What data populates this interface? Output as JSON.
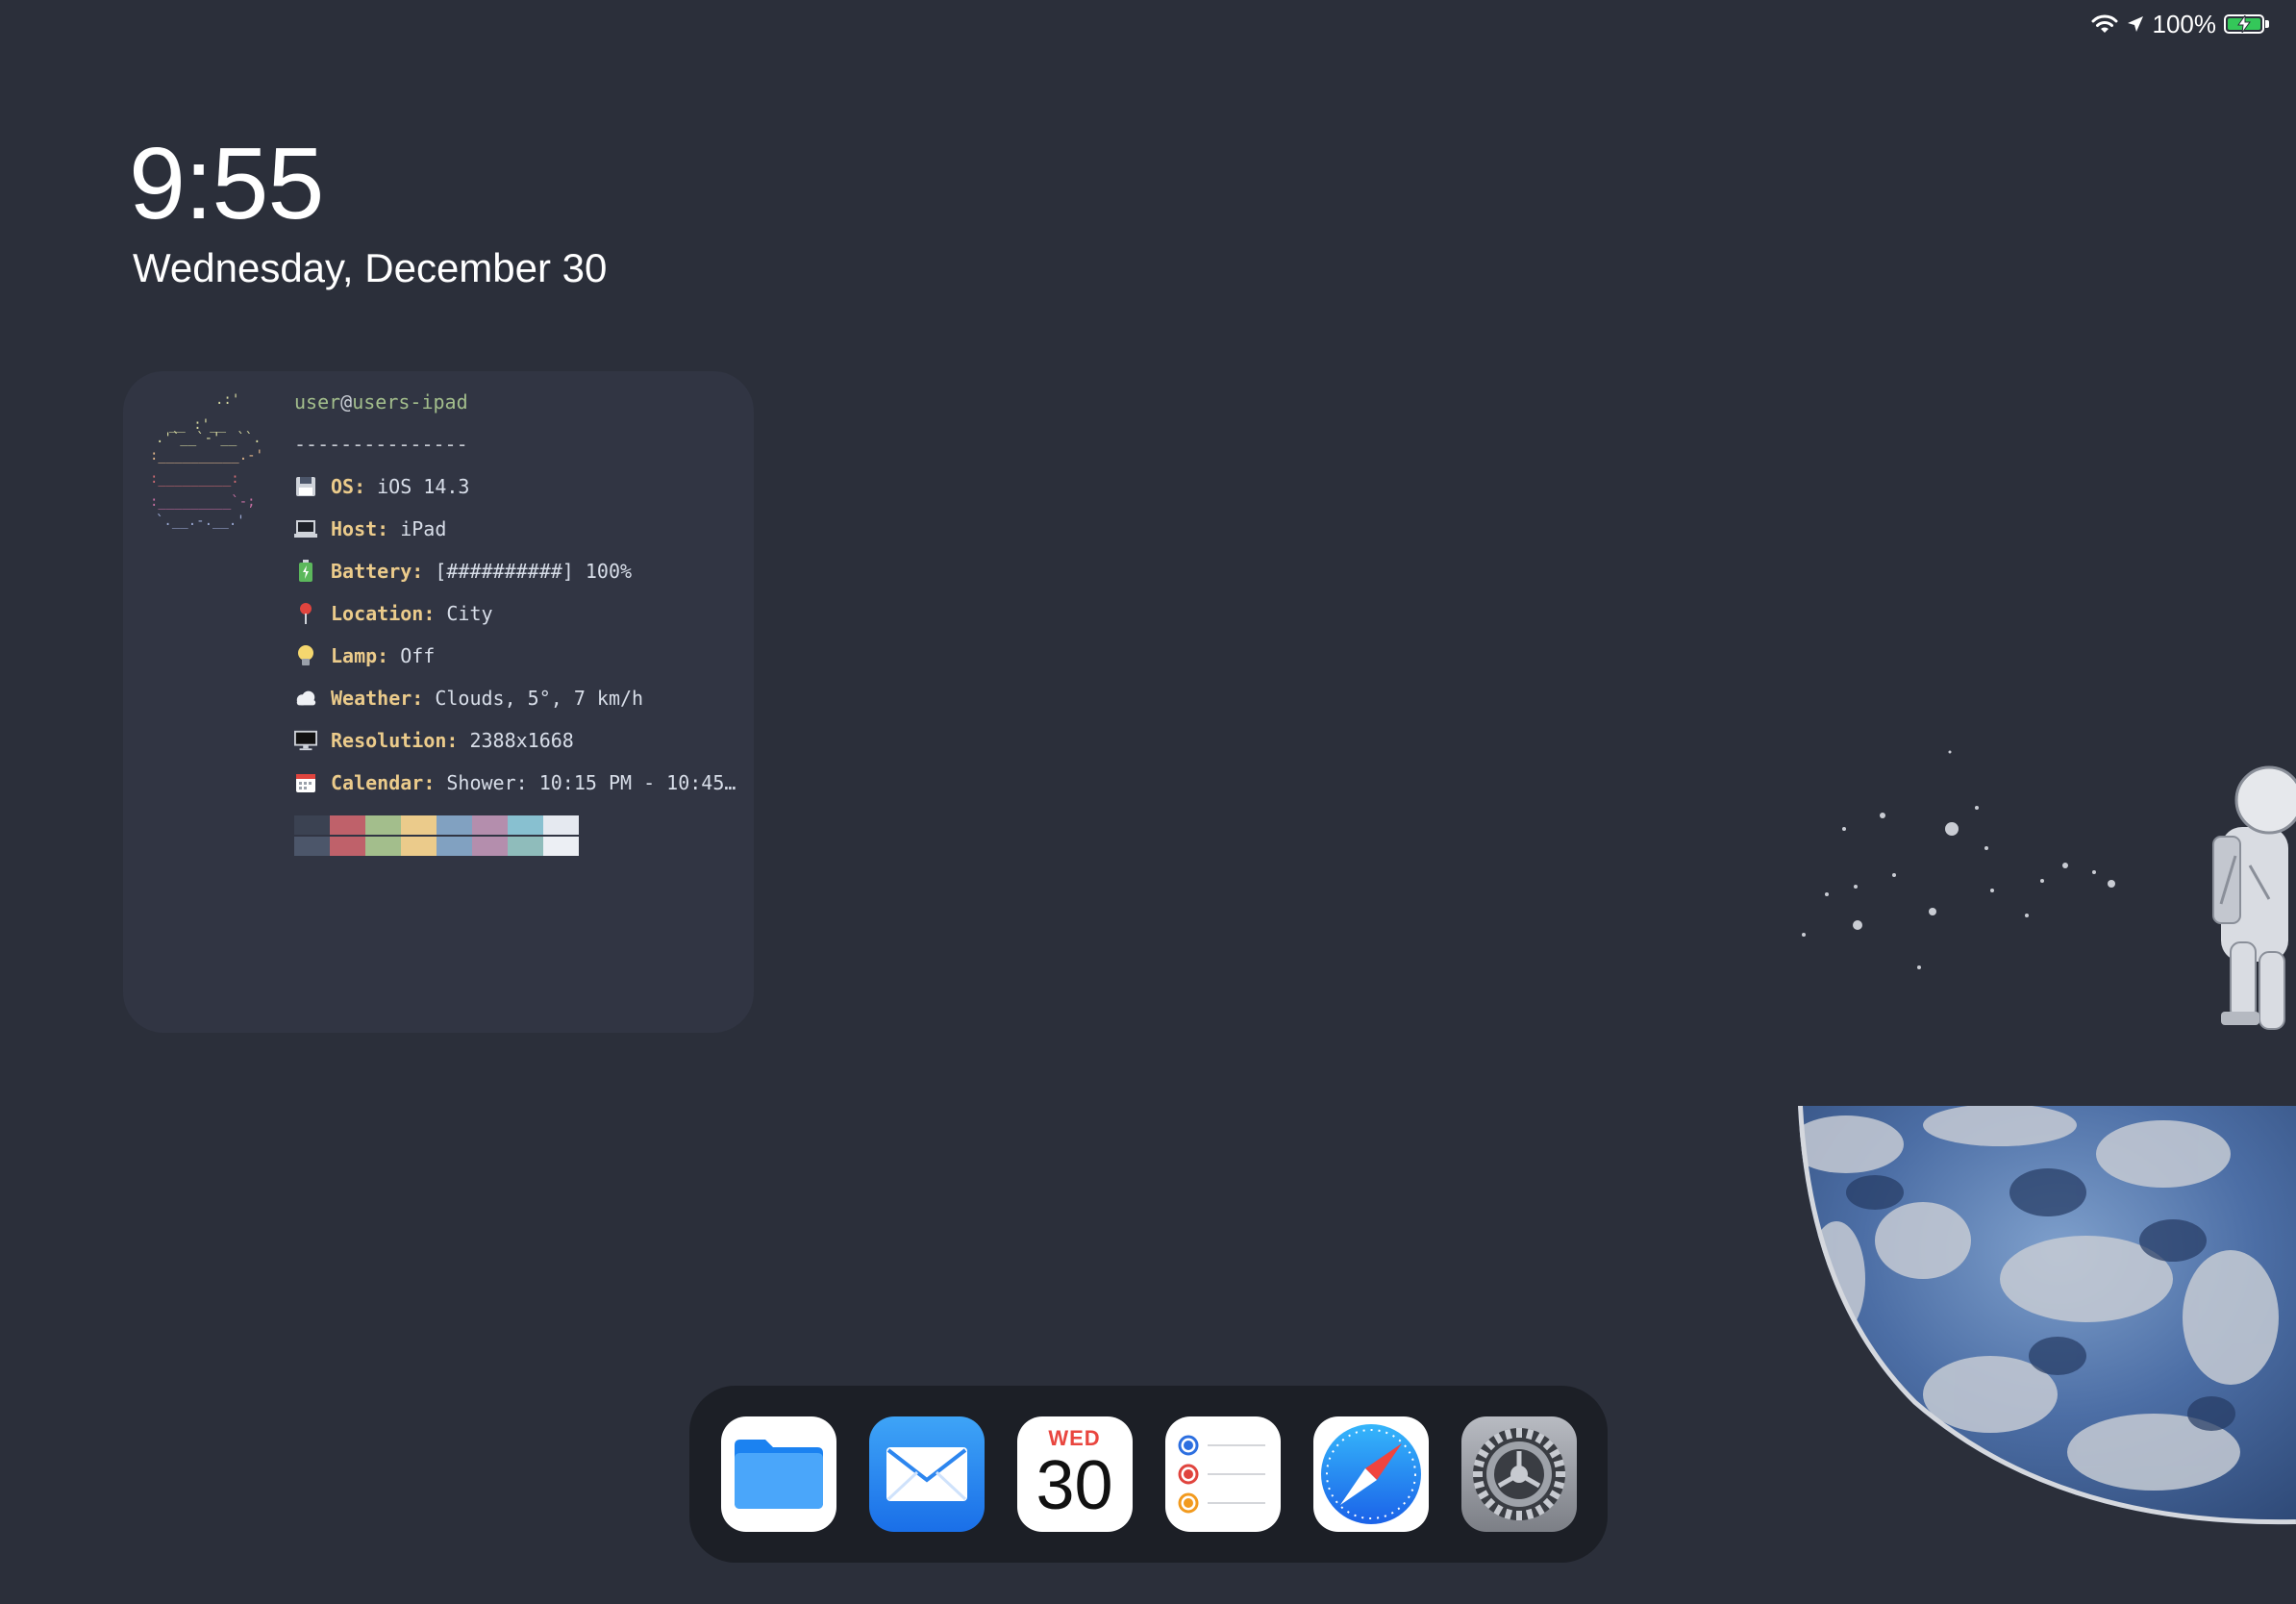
{
  "status_bar": {
    "battery_text": "100%",
    "battery_level": 1.0,
    "battery_color": "#34c759",
    "icons": [
      "wifi-icon",
      "location-arrow-icon",
      "battery-charging-icon"
    ]
  },
  "lock": {
    "time": "9:55",
    "date": "Wednesday, December 30"
  },
  "widget": {
    "user": "user",
    "at": "@",
    "host": "users-ipad",
    "separator": "---------------",
    "rows": [
      {
        "icon": "floppy-disk-icon",
        "key": "OS:",
        "value": "iOS 14.3"
      },
      {
        "icon": "laptop-icon",
        "key": "Host:",
        "value": "iPad"
      },
      {
        "icon": "battery-icon",
        "key": "Battery:",
        "value": "[##########] 100%"
      },
      {
        "icon": "pin-icon",
        "key": "Location:",
        "value": "City"
      },
      {
        "icon": "lightbulb-icon",
        "key": "Lamp:",
        "value": "Off"
      },
      {
        "icon": "cloud-icon",
        "key": "Weather:",
        "value": "Clouds, 5°, 7 km/h"
      },
      {
        "icon": "monitor-icon",
        "key": "Resolution:",
        "value": "2388x1668"
      },
      {
        "icon": "calendar-icon",
        "key": "Calendar:",
        "value": "Shower: 10:15 PM - 10:45…"
      }
    ],
    "palette_top": [
      "#3b4252",
      "#bf616a",
      "#a3be8c",
      "#ebcb8b",
      "#81a1c1",
      "#b48ead",
      "#88c0d0",
      "#e5e9f0"
    ],
    "palette_bottom": [
      "#4c566a",
      "#bf616a",
      "#a3be8c",
      "#ebcb8b",
      "#81a1c1",
      "#b48ead",
      "#8fbcbb",
      "#eceff4"
    ]
  },
  "dock": {
    "apps": [
      {
        "name": "Files",
        "icon": "folder-icon"
      },
      {
        "name": "Mail",
        "icon": "envelope-icon"
      },
      {
        "name": "Calendar",
        "icon": "calendar-app-icon",
        "day": "WED",
        "date": "30"
      },
      {
        "name": "Reminders",
        "icon": "checklist-icon"
      },
      {
        "name": "Safari",
        "icon": "compass-icon"
      },
      {
        "name": "Settings",
        "icon": "gear-icon"
      }
    ]
  }
}
